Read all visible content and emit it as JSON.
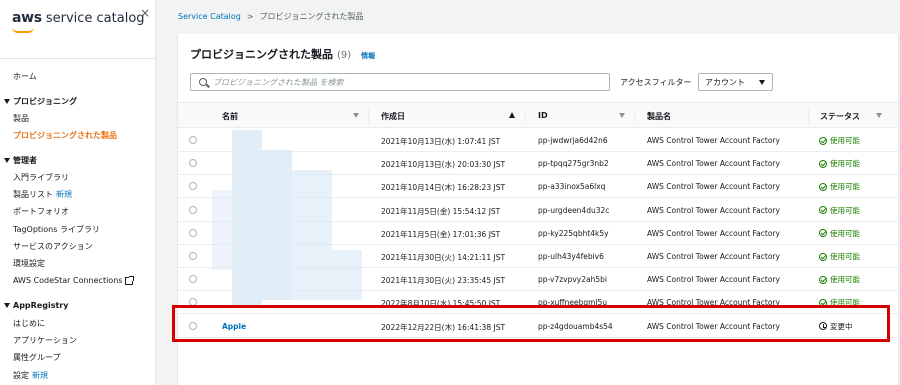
{
  "sidebar": {
    "logo_aws": "aws",
    "logo_service": "service catalog",
    "close": "×",
    "home": "ホーム",
    "provisioning_head": "プロビジョニング",
    "products": "製品",
    "provisioned_products": "プロビジョニングされた製品",
    "admin_head": "管理者",
    "getting_started": "入門ライブラリ",
    "product_list": "製品リスト",
    "product_list_new": "新規",
    "portfolio": "ポートフォリオ",
    "tag_options": "TagOptions ライブラリ",
    "service_actions": "サービスのアクション",
    "settings_env": "環境設定",
    "codestar": "AWS CodeStar Connections",
    "appregistry_head": "AppRegistry",
    "intro": "はじめに",
    "applications": "アプリケーション",
    "attribute_groups": "属性グループ",
    "settings": "設定",
    "settings_new": "新規"
  },
  "breadcrumb": {
    "root": "Service Catalog",
    "separator": ">",
    "current": "プロビジョニングされた製品"
  },
  "panel": {
    "title": "プロビジョニングされた製品",
    "count": "(9)",
    "info": "情報",
    "search_placeholder": "プロビジョニングされた製品 を検索",
    "filter_label": "アクセスフィルター",
    "filter_value": "アカウント"
  },
  "table": {
    "headers": [
      "名前",
      "作成日",
      "ID",
      "製品名",
      "ステータス"
    ],
    "sorted_column": "作成日",
    "rows": [
      {
        "name": "",
        "created": "2021年10月13日(水) 1:07:41 JST",
        "id": "pp-jwdwrja6d42n6",
        "product": "AWS Control Tower Account Factory",
        "status": "使用可能",
        "status_type": "ok"
      },
      {
        "name": "",
        "created": "2021年10月13日(水) 20:03:30 JST",
        "id": "pp-tpqq275gr3nb2",
        "product": "AWS Control Tower Account Factory",
        "status": "使用可能",
        "status_type": "ok"
      },
      {
        "name": "",
        "created": "2021年10月14日(木) 16:28:23 JST",
        "id": "pp-a33inox5a6lxq",
        "product": "AWS Control Tower Account Factory",
        "status": "使用可能",
        "status_type": "ok"
      },
      {
        "name": "",
        "created": "2021年11月5日(金) 15:54:12 JST",
        "id": "pp-urgdeen4du32c",
        "product": "AWS Control Tower Account Factory",
        "status": "使用可能",
        "status_type": "ok"
      },
      {
        "name": "",
        "created": "2021年11月5日(金) 17:01:36 JST",
        "id": "pp-ky225qbht4k5y",
        "product": "AWS Control Tower Account Factory",
        "status": "使用可能",
        "status_type": "ok"
      },
      {
        "name": "",
        "created": "2021年11月30日(火) 14:21:11 JST",
        "id": "pp-ulh43y4febiv6",
        "product": "AWS Control Tower Account Factory",
        "status": "使用可能",
        "status_type": "ok"
      },
      {
        "name": "",
        "created": "2021年11月30日(火) 23:35:45 JST",
        "id": "pp-v7zvpvy2ah5bi",
        "product": "AWS Control Tower Account Factory",
        "status": "使用可能",
        "status_type": "ok"
      },
      {
        "name": "",
        "created": "2022年8月10日(水) 15:45:50 JST",
        "id": "pp-xuffneebqml5u",
        "product": "AWS Control Tower Account Factory",
        "status": "使用可能",
        "status_type": "ok"
      },
      {
        "name": "Apple",
        "created": "2022年12月22日(木) 16:41:38 JST",
        "id": "pp-z4gdouamb4s54",
        "product": "AWS Control Tower Account Factory",
        "status": "変更中",
        "status_type": "change"
      }
    ]
  },
  "colors": {
    "accent": "#ec7211",
    "link": "#0073bb",
    "success": "#1d8102",
    "highlight": "#d40000"
  }
}
